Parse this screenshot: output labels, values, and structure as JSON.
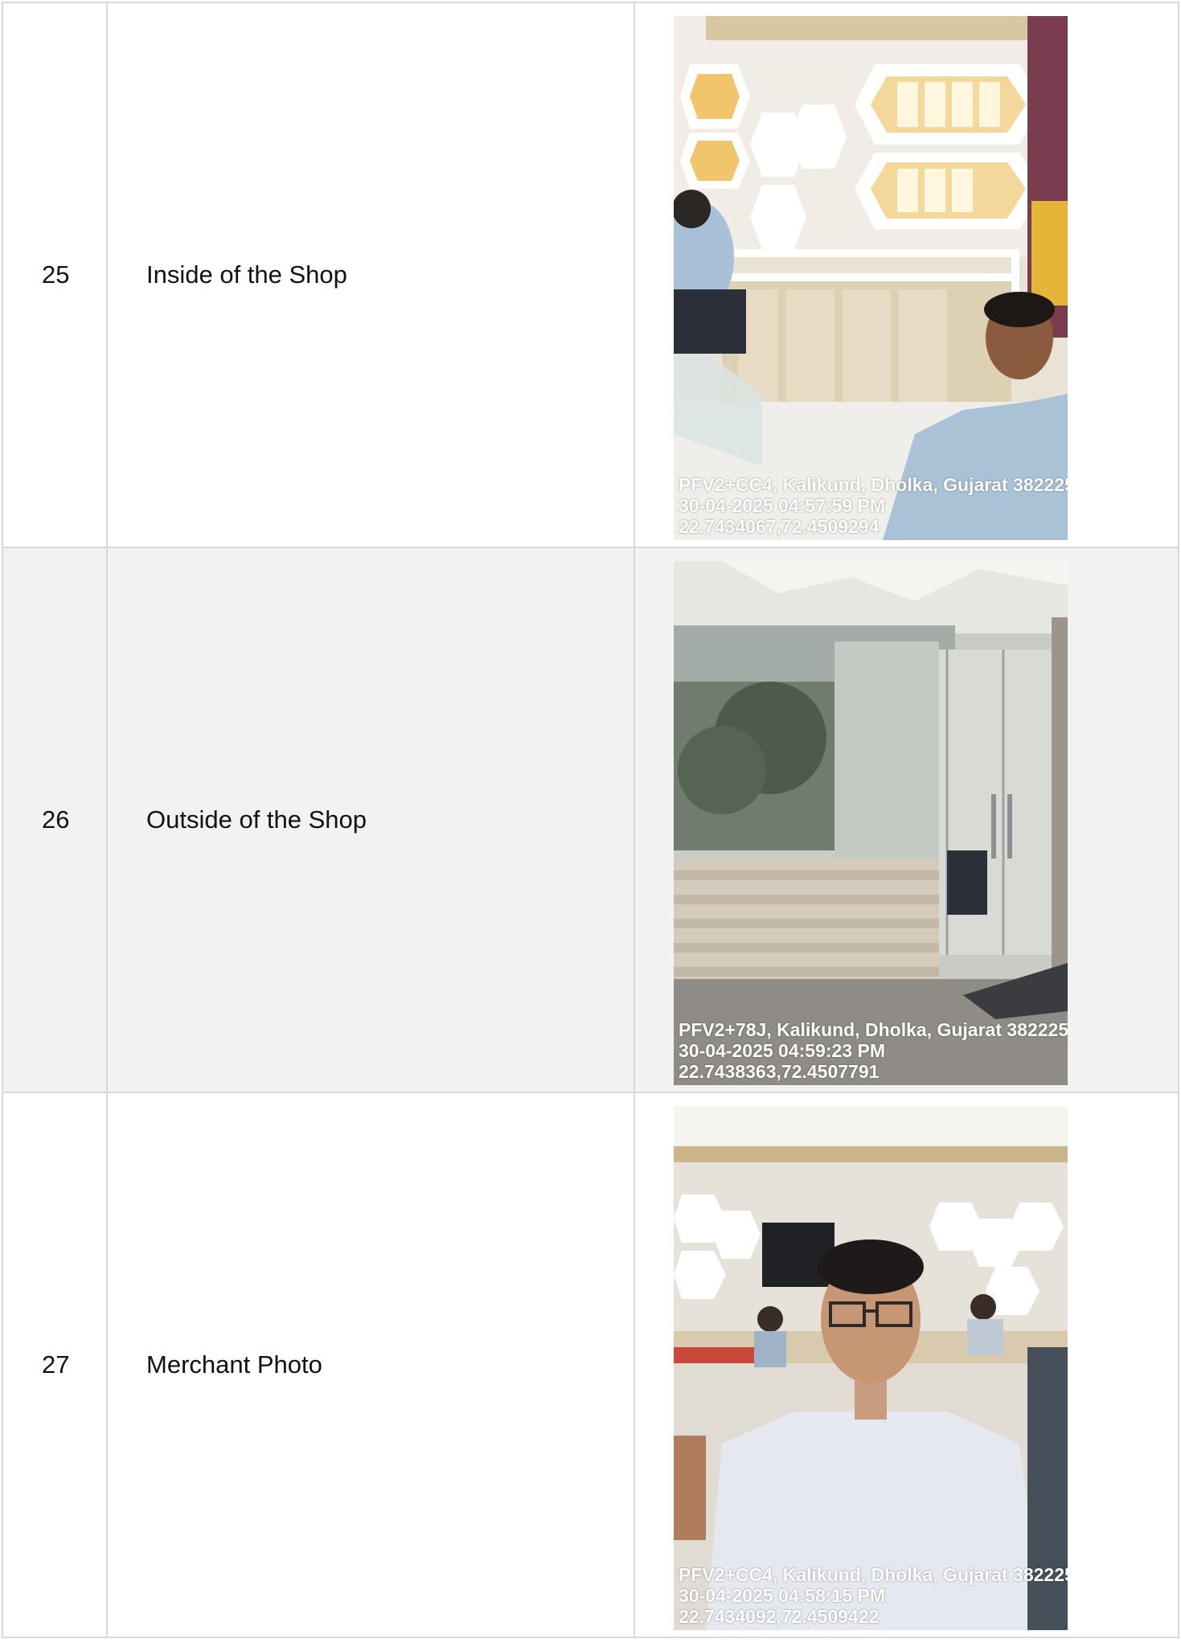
{
  "rows": [
    {
      "no": "25",
      "description": "Inside of the Shop",
      "photo": {
        "subject": "shop interior with jewellery display cases",
        "stamp_address": "PFV2+CC4, Kalikund, Dholka, Gujarat 382225",
        "stamp_datetime": "30-04-2025 04:57:59 PM",
        "stamp_coords": "22.7434067,72.4509294"
      }
    },
    {
      "no": "26",
      "description": "Outside of the Shop",
      "photo": {
        "subject": "shop front with glass doors",
        "stamp_address": "PFV2+78J, Kalikund, Dholka, Gujarat 382225",
        "stamp_datetime": "30-04-2025 04:59:23 PM",
        "stamp_coords": "22.7438363,72.4507791"
      }
    },
    {
      "no": "27",
      "description": "Merchant Photo",
      "photo": {
        "subject": "merchant portrait inside the shop",
        "stamp_address": "PFV2+CC4, Kalikund, Dholka, Gujarat 382225",
        "stamp_datetime": "30-04-2025 04:58:15 PM",
        "stamp_coords": "22.7434092,72.4509422"
      }
    }
  ],
  "colors": {
    "border": "#d9d9d9",
    "alt_row": "#f2f2f2",
    "text": "#111111",
    "stamp_text": "#ffffff"
  }
}
